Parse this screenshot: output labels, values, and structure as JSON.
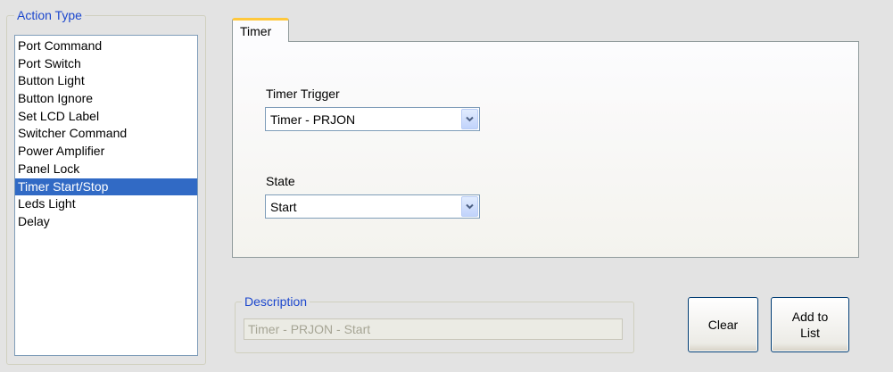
{
  "action_type": {
    "title": "Action Type",
    "items": [
      {
        "label": "Port Command"
      },
      {
        "label": "Port Switch"
      },
      {
        "label": "Button Light"
      },
      {
        "label": "Button Ignore"
      },
      {
        "label": "Set LCD Label"
      },
      {
        "label": "Switcher Command"
      },
      {
        "label": "Power Amplifier"
      },
      {
        "label": "Panel Lock"
      },
      {
        "label": "Timer Start/Stop",
        "selected": true
      },
      {
        "label": "Leds Light"
      },
      {
        "label": "Delay"
      }
    ]
  },
  "tab": {
    "label": "Timer",
    "timer_trigger": {
      "label": "Timer Trigger",
      "value": "Timer - PRJON"
    },
    "state": {
      "label": "State",
      "value": "Start"
    }
  },
  "description": {
    "title": "Description",
    "value": "Timer - PRJON - Start"
  },
  "buttons": {
    "clear": "Clear",
    "add_to_list": "Add to\nList"
  },
  "colors": {
    "group_title": "#1c47cd",
    "selection": "#316ac5",
    "tab_highlight": "#ffc83c",
    "combo_arrow": "#4d6185"
  },
  "icons": {
    "combo_arrow": "chevron-down-icon"
  }
}
